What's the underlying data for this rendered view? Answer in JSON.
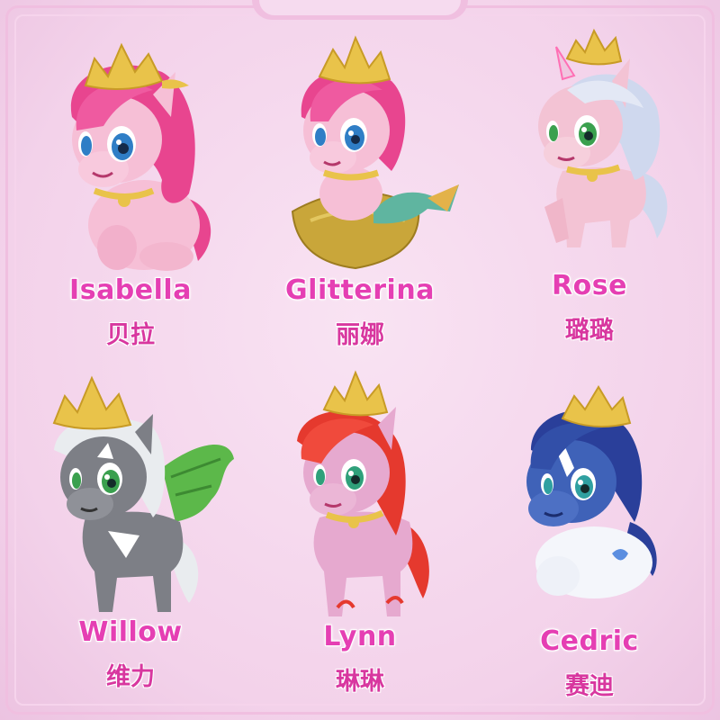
{
  "characters": [
    {
      "name": "Isabella",
      "name_cn": "贝拉",
      "body_color": "#f6bfd6",
      "mane_color": "#e8458f",
      "eye_color": "#2f7ec6",
      "accessory": "crown-icon"
    },
    {
      "name": "Glitterina",
      "name_cn": "丽娜",
      "body_color": "#f6bfd6",
      "mane_color": "#e8458f",
      "eye_color": "#2f7ec6",
      "accessory": "crown-icon"
    },
    {
      "name": "Rose",
      "name_cn": "璐璐",
      "body_color": "#f3c3d4",
      "mane_color": "#cfd8ee",
      "eye_color": "#3aa04e",
      "accessory": "crown-icon"
    },
    {
      "name": "Willow",
      "name_cn": "维力",
      "body_color": "#7d7f86",
      "mane_color": "#e9ecef",
      "eye_color": "#3aa04e",
      "accessory": "crown-icon"
    },
    {
      "name": "Lynn",
      "name_cn": "琳琳",
      "body_color": "#e6a9cf",
      "mane_color": "#e5392e",
      "eye_color": "#2fa07a",
      "accessory": "crown-icon"
    },
    {
      "name": "Cedric",
      "name_cn": "赛迪",
      "body_color": "#3f62b8",
      "mane_color": "#2a3f9a",
      "eye_color": "#2fa0a0",
      "accessory": "crown-icon"
    }
  ],
  "colors": {
    "background": "#f5d7ee",
    "title_text": "#e53fb3",
    "crown_gold": "#e9c34a"
  }
}
